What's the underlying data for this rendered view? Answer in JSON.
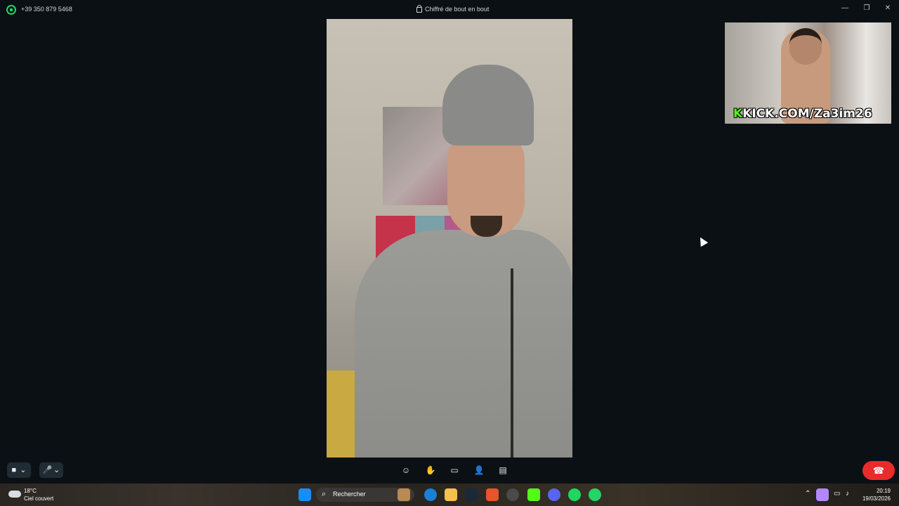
{
  "window": {
    "phone_number": "+39 350 879 5468",
    "encryption_notice": "Chiffré de bout en bout",
    "minimize": "—",
    "maximize": "❐",
    "close": "✕"
  },
  "self_view": {
    "overlay_k": "K",
    "overlay_rest": "KICK.COM/Za3im26"
  },
  "controls": {
    "video_icon": "■",
    "mic_icon": "🎤",
    "chevron": "⌄",
    "center": [
      "☺",
      "✋",
      "▭",
      "👤",
      "▤"
    ],
    "end_call_icon": "☎"
  },
  "taskbar": {
    "weather_temp": "18°C",
    "weather_desc": "Ciel couvert",
    "search_placeholder": "Rechercher",
    "time": "20:19",
    "date": "19/03/2026"
  }
}
